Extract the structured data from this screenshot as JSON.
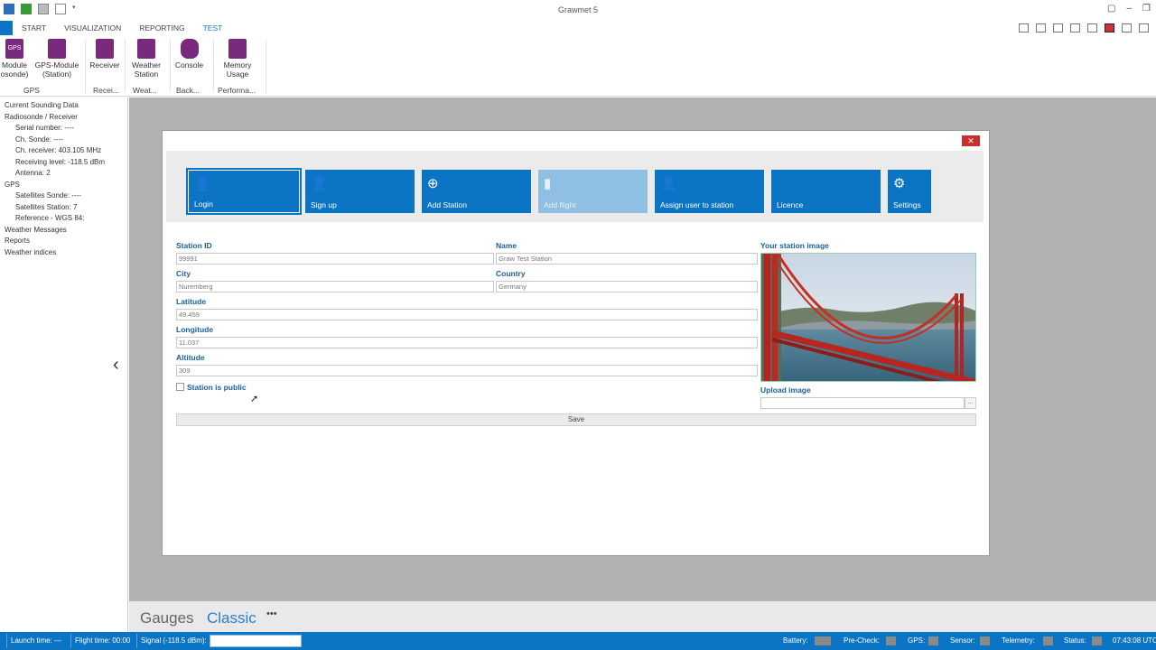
{
  "app": {
    "title": "Grawmet 5"
  },
  "ribbon": {
    "tabs": [
      "START",
      "VISUALIZATION",
      "REPORTING",
      "TEST"
    ],
    "active_tab": "TEST",
    "buttons": [
      {
        "label": "Module\nosonde)",
        "icon": "gps-icon",
        "icon_text": "GPS"
      },
      {
        "label": "GPS-Module\n(Station)",
        "icon": "gps-station-icon"
      },
      {
        "label": "Receiver",
        "icon": "receiver-icon"
      },
      {
        "label": "Weather\nStation",
        "icon": "weather-station-icon"
      },
      {
        "label": "Console",
        "icon": "console-icon"
      },
      {
        "label": "Memory\nUsage",
        "icon": "memory-chip-icon"
      }
    ],
    "groups": [
      "GPS",
      "Recei...",
      "Weat...",
      "Back...",
      "Performa..."
    ]
  },
  "tree": {
    "items": [
      "Current Sounding Data",
      "Radiosonde / Receiver",
      "Serial number: ----",
      "Ch. Sonde: ----",
      "Ch. receiver: 403.105 MHz",
      "Receiving level: -118.5 dBm",
      "Antenna: 2",
      "GPS",
      "Satellites Sonde: ----",
      "Satellites Station: 7",
      "Reference - WGS 84:",
      "Weather Messages",
      "Reports",
      "Weather indices"
    ]
  },
  "dialog": {
    "close_label": "✕",
    "tiles": [
      {
        "label": "Login",
        "icon": "user-icon"
      },
      {
        "label": "Sign up",
        "icon": "user-add-icon"
      },
      {
        "label": "Add Station",
        "icon": "plus-circle-icon"
      },
      {
        "label": "Add flight",
        "icon": "flight-icon"
      },
      {
        "label": "Assign user to station",
        "icon": "user-assign-icon"
      },
      {
        "label": "Licence",
        "icon": "licence-icon"
      },
      {
        "label": "Settings",
        "icon": "gears-icon"
      }
    ],
    "fields": {
      "station_id": {
        "label": "Station ID",
        "value": "99991"
      },
      "name": {
        "label": "Name",
        "value": "Graw Test Station"
      },
      "city": {
        "label": "City",
        "value": "Nuremberg"
      },
      "country": {
        "label": "Country",
        "value": "Germany"
      },
      "latitude": {
        "label": "Latitude",
        "value": "49.459"
      },
      "longitude": {
        "label": "Longitude",
        "value": "11.037"
      },
      "altitude": {
        "label": "Altitude",
        "value": "309"
      }
    },
    "public_label": "Station is public",
    "image_label": "Your station image",
    "upload_label": "Upload image",
    "upload_button": "...",
    "save_label": "Save"
  },
  "viewbar": {
    "items": [
      "Gauges",
      "Classic",
      "•••"
    ],
    "active": "Classic"
  },
  "status": {
    "launch_time": "Launch time: ---",
    "flight_time": "Flight time: 00:00",
    "signal": "Signal (-118.5 dBm):",
    "battery": "Battery:",
    "precheck": "Pre-Check:",
    "gps": "GPS:",
    "sensor": "Sensor:",
    "telemetry": "Telemetry:",
    "status": "Status:",
    "clock": "07:43:08 UTC"
  }
}
